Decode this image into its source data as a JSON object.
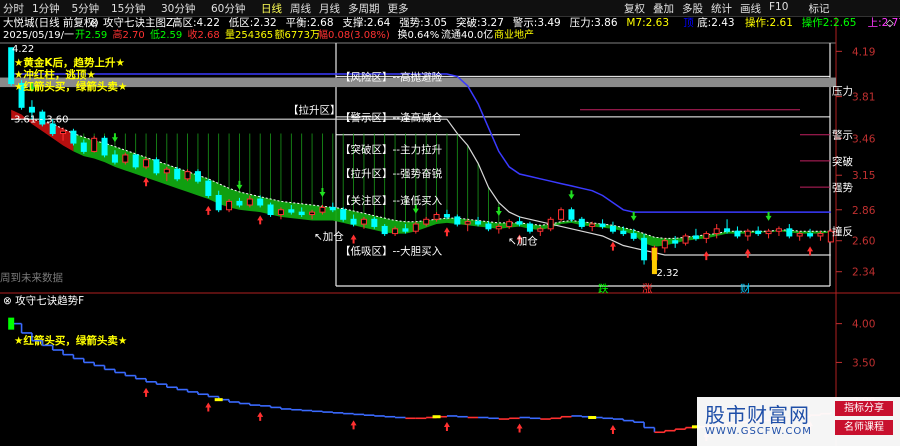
{
  "toolbar": {
    "left_items": [
      "分时",
      "1分钟",
      "5分钟",
      "15分钟",
      "30分钟",
      "60分钟",
      "日线",
      "周线",
      "月线",
      "多周期",
      "更多"
    ],
    "active": "日线",
    "right_items": [
      "复权",
      "叠加",
      "多股",
      "统计",
      "画线",
      "F10",
      "标记"
    ],
    "icons": [
      "chevron-down-icon",
      "pin-icon",
      "maximize-icon"
    ]
  },
  "colors": {
    "background": "#000000",
    "up": "#ff3232",
    "down": "#00ffff",
    "ma_cyan": "#00ffff",
    "cloud_green": "#11a811",
    "cloud_red": "#c01010",
    "upper_band": "#3a3aff",
    "lower_band": "#d8d8d8",
    "axis_red": "#c03030",
    "label_yellow": "#ffff00",
    "label_white": "#ffffff"
  },
  "main_panel": {
    "stock_name": "大悦城(日线 前复权)",
    "indicator_name": "攻守七诀主图Z",
    "indicators": [
      {
        "label": "高区:",
        "value": "4.22",
        "color": "#ffffff"
      },
      {
        "label": "低区:",
        "value": "2.32",
        "color": "#ffffff"
      },
      {
        "label": "平衡:",
        "value": "2.68",
        "color": "#ffffff"
      },
      {
        "label": "支撑:",
        "value": "2.64",
        "color": "#ffffff"
      },
      {
        "label": "强势:",
        "value": "3.05",
        "color": "#ffffff"
      },
      {
        "label": "突破:",
        "value": "3.27",
        "color": "#ffffff"
      },
      {
        "label": "警示:",
        "value": "3.49",
        "color": "#ffffff"
      },
      {
        "label": "压力:",
        "value": "3.86",
        "color": "#ffffff"
      },
      {
        "label": "M7:",
        "value": "2.63",
        "color": "#ffff00"
      },
      {
        "label": "顶",
        "value": "",
        "color": "#0000ff"
      },
      {
        "label": "底:",
        "value": "2.43",
        "color": "#ffffff"
      },
      {
        "label": "操作:",
        "value": "2.61",
        "color": "#ffff00"
      },
      {
        "label": "操作2:",
        "value": "2.65",
        "color": "#00ff00"
      },
      {
        "label": "上:",
        "value": "2.77",
        "color": "#ff3aff"
      },
      {
        "label": "下:",
        "value": "",
        "color": "#00ffff"
      }
    ],
    "quote_date": "2025/05/19/一",
    "quote": [
      {
        "label": "开",
        "value": "2.59",
        "color": "#00ff00"
      },
      {
        "label": "高",
        "value": "2.70",
        "color": "#ff3232"
      },
      {
        "label": "低",
        "value": "2.59",
        "color": "#00ff00"
      },
      {
        "label": "收",
        "value": "2.68",
        "color": "#ff3232"
      },
      {
        "label": "量",
        "value": "254365",
        "color": "#ffff00"
      },
      {
        "label": "额",
        "value": "6773万",
        "color": "#ffff00"
      },
      {
        "label": "幅",
        "value": "0.08(3.08%)",
        "color": "#ff3232"
      },
      {
        "label": "换",
        "value": "0.64%",
        "color": "#ffffff"
      },
      {
        "label": "流通",
        "value": "40.0亿",
        "color": "#ffffff"
      },
      {
        "label": "",
        "value": "商业地产",
        "color": "#ffff00"
      }
    ],
    "signals": [
      "★黄金K后，趋势上升★",
      "★冲红柱，逃顶★",
      "★红箭头买，绿箭头卖★"
    ],
    "watermark_note": "周到未来数据",
    "zone_labels": [
      {
        "text": "【风险区】--高抛避险",
        "value": 3.98
      },
      {
        "text": "【拉升区】",
        "value": 3.7
      },
      {
        "text": "【警示区】--逢高减仓",
        "value": 3.64
      },
      {
        "text": "【突破区】--主力拉升",
        "value": 3.37
      },
      {
        "text": "【拉升区】--强势奋锐",
        "value": 3.17
      },
      {
        "text": "【关注区】--逢低买入",
        "value": 2.94
      },
      {
        "text": "【低吸区】--大胆买入",
        "value": 2.52
      }
    ],
    "level_tags": [
      {
        "text": "压力",
        "value": 3.86
      },
      {
        "text": "警示",
        "value": 3.49
      },
      {
        "text": "突破",
        "value": 3.27
      },
      {
        "text": "强势",
        "value": 3.05
      },
      {
        "text": "撞反",
        "value": 2.68
      }
    ],
    "price_labels": [
      {
        "text": "4.22",
        "value": 4.22
      },
      {
        "text": "3.61 - 3.60",
        "value": 3.61
      },
      {
        "text": "2.32",
        "value": 2.32
      }
    ],
    "jiacang_labels": [
      "加仓",
      "加仓"
    ],
    "bottom_labels": [
      {
        "text": "跌",
        "color": "#00ff00"
      },
      {
        "text": "涨",
        "color": "#ff3232"
      },
      {
        "text": "财",
        "color": "#00ccff"
      }
    ]
  },
  "sub_panel": {
    "indicator_name": "攻守七诀趋势F",
    "signal": "★红箭头买，绿箭头卖★"
  },
  "watermark": {
    "title": "股市财富网",
    "url": "WWW.GSCFW.COM",
    "tag1": "指标分享",
    "tag2": "名师课程"
  },
  "chart_data": [
    {
      "type": "candlestick",
      "title": "攻守七诀主图Z",
      "y_ticks": [
        4.19,
        3.81,
        3.46,
        3.15,
        2.86,
        2.6,
        2.34
      ],
      "ylim": [
        2.22,
        4.26
      ],
      "levels": {
        "高区": 4.22,
        "低区": 2.32,
        "平衡": 2.68,
        "支撑": 2.64,
        "强势": 3.05,
        "突破": 3.27,
        "警示": 3.49,
        "压力": 3.86
      },
      "candles": [
        [
          4.22,
          4.22,
          3.9,
          3.92
        ],
        [
          3.92,
          3.95,
          3.7,
          3.72
        ],
        [
          3.72,
          3.78,
          3.62,
          3.68
        ],
        [
          3.68,
          3.7,
          3.56,
          3.58
        ],
        [
          3.58,
          3.62,
          3.48,
          3.5
        ],
        [
          3.5,
          3.55,
          3.44,
          3.52
        ],
        [
          3.52,
          3.54,
          3.4,
          3.42
        ],
        [
          3.42,
          3.45,
          3.33,
          3.35
        ],
        [
          3.35,
          3.48,
          3.34,
          3.46
        ],
        [
          3.46,
          3.48,
          3.3,
          3.32
        ],
        [
          3.32,
          3.36,
          3.24,
          3.26
        ],
        [
          3.26,
          3.34,
          3.24,
          3.32
        ],
        [
          3.32,
          3.33,
          3.2,
          3.22
        ],
        [
          3.22,
          3.3,
          3.2,
          3.28
        ],
        [
          3.28,
          3.3,
          3.15,
          3.17
        ],
        [
          3.17,
          3.22,
          3.1,
          3.2
        ],
        [
          3.2,
          3.22,
          3.1,
          3.12
        ],
        [
          3.12,
          3.2,
          3.1,
          3.18
        ],
        [
          3.18,
          3.2,
          3.08,
          3.1
        ],
        [
          3.1,
          3.12,
          2.96,
          2.98
        ],
        [
          2.98,
          3.02,
          2.84,
          2.86
        ],
        [
          2.86,
          2.95,
          2.84,
          2.93
        ],
        [
          2.93,
          2.96,
          2.88,
          2.9
        ],
        [
          2.9,
          2.98,
          2.88,
          2.95
        ],
        [
          2.95,
          2.98,
          2.88,
          2.9
        ],
        [
          2.9,
          2.92,
          2.8,
          2.82
        ],
        [
          2.82,
          2.88,
          2.78,
          2.86
        ],
        [
          2.86,
          2.9,
          2.82,
          2.84
        ],
        [
          2.84,
          2.88,
          2.8,
          2.82
        ],
        [
          2.82,
          2.86,
          2.78,
          2.84
        ],
        [
          2.84,
          2.9,
          2.82,
          2.88
        ],
        [
          2.88,
          2.92,
          2.84,
          2.86
        ],
        [
          2.86,
          2.88,
          2.76,
          2.78
        ],
        [
          2.78,
          2.82,
          2.72,
          2.74
        ],
        [
          2.74,
          2.8,
          2.7,
          2.78
        ],
        [
          2.78,
          2.8,
          2.7,
          2.72
        ],
        [
          2.72,
          2.74,
          2.64,
          2.66
        ],
        [
          2.66,
          2.72,
          2.64,
          2.7
        ],
        [
          2.7,
          2.74,
          2.66,
          2.68
        ],
        [
          2.68,
          2.76,
          2.66,
          2.74
        ],
        [
          2.74,
          2.8,
          2.72,
          2.78
        ],
        [
          2.78,
          2.84,
          2.76,
          2.82
        ],
        [
          2.82,
          2.86,
          2.78,
          2.8
        ],
        [
          2.8,
          2.82,
          2.72,
          2.74
        ],
        [
          2.74,
          2.78,
          2.68,
          2.76
        ],
        [
          2.76,
          2.8,
          2.72,
          2.74
        ],
        [
          2.74,
          2.76,
          2.68,
          2.7
        ],
        [
          2.7,
          2.74,
          2.66,
          2.72
        ],
        [
          2.72,
          2.78,
          2.7,
          2.76
        ],
        [
          2.76,
          2.8,
          2.72,
          2.74
        ],
        [
          2.74,
          2.76,
          2.66,
          2.68
        ],
        [
          2.68,
          2.72,
          2.64,
          2.7
        ],
        [
          2.7,
          2.8,
          2.68,
          2.78
        ],
        [
          2.78,
          2.88,
          2.76,
          2.86
        ],
        [
          2.86,
          2.88,
          2.76,
          2.78
        ],
        [
          2.78,
          2.8,
          2.7,
          2.72
        ],
        [
          2.72,
          2.76,
          2.68,
          2.74
        ],
        [
          2.74,
          2.78,
          2.7,
          2.72
        ],
        [
          2.72,
          2.76,
          2.66,
          2.68
        ],
        [
          2.68,
          2.72,
          2.64,
          2.66
        ],
        [
          2.66,
          2.7,
          2.6,
          2.62
        ],
        [
          2.62,
          2.66,
          2.4,
          2.44
        ],
        [
          2.44,
          2.56,
          2.32,
          2.54
        ],
        [
          2.54,
          2.62,
          2.5,
          2.6
        ],
        [
          2.6,
          2.64,
          2.54,
          2.58
        ],
        [
          2.58,
          2.66,
          2.56,
          2.64
        ],
        [
          2.64,
          2.7,
          2.6,
          2.62
        ],
        [
          2.62,
          2.68,
          2.58,
          2.66
        ],
        [
          2.66,
          2.74,
          2.62,
          2.7
        ],
        [
          2.7,
          2.78,
          2.66,
          2.68
        ],
        [
          2.68,
          2.72,
          2.62,
          2.64
        ],
        [
          2.64,
          2.7,
          2.6,
          2.68
        ],
        [
          2.68,
          2.72,
          2.64,
          2.66
        ],
        [
          2.66,
          2.7,
          2.62,
          2.68
        ],
        [
          2.68,
          2.72,
          2.64,
          2.7
        ],
        [
          2.7,
          2.74,
          2.62,
          2.64
        ],
        [
          2.64,
          2.68,
          2.6,
          2.66
        ],
        [
          2.66,
          2.7,
          2.62,
          2.64
        ],
        [
          2.64,
          2.68,
          2.6,
          2.66
        ],
        [
          2.59,
          2.7,
          2.59,
          2.68
        ]
      ],
      "upper_band": [
        4.0,
        4.0,
        4.0,
        4.0,
        4.0,
        4.0,
        4.0,
        4.0,
        4.0,
        4.0,
        4.0,
        4.0,
        4.0,
        4.0,
        4.0,
        4.0,
        4.0,
        4.0,
        4.0,
        4.0,
        4.0,
        4.0,
        4.0,
        4.0,
        4.0,
        4.0,
        4.0,
        4.0,
        4.0,
        4.0,
        4.0,
        4.0,
        4.0,
        4.0,
        4.0,
        4.0,
        4.0,
        4.0,
        4.0,
        4.0,
        4.0,
        4.0,
        4.0,
        3.98,
        3.9,
        3.75,
        3.55,
        3.35,
        3.22,
        3.16,
        3.14,
        3.12,
        3.1,
        3.08,
        3.06,
        3.04,
        3.02,
        2.98,
        2.92,
        2.86,
        2.84,
        2.84,
        2.84,
        2.84,
        2.84,
        2.84,
        2.84,
        2.84,
        2.84,
        2.84,
        2.84,
        2.84,
        2.84,
        2.84,
        2.84,
        2.84,
        2.84,
        2.84,
        2.84,
        2.84
      ],
      "lower_band": [
        3.62,
        3.62,
        3.62,
        3.62,
        3.62,
        3.62,
        3.62,
        3.62,
        3.62,
        3.62,
        3.62,
        3.62,
        3.62,
        3.62,
        3.62,
        3.62,
        3.62,
        3.62,
        3.62,
        3.62,
        3.62,
        3.62,
        3.62,
        3.62,
        3.62,
        3.62,
        3.62,
        3.62,
        3.62,
        3.62,
        3.62,
        3.62,
        3.62,
        3.62,
        3.62,
        3.62,
        3.62,
        3.62,
        3.62,
        3.62,
        3.62,
        3.62,
        3.62,
        3.5,
        3.4,
        3.25,
        3.05,
        2.92,
        2.84,
        2.8,
        2.78,
        2.76,
        2.74,
        2.72,
        2.7,
        2.68,
        2.66,
        2.64,
        2.6,
        2.56,
        2.54,
        2.52,
        2.5,
        2.48,
        2.48,
        2.48,
        2.48,
        2.48,
        2.48,
        2.48,
        2.48,
        2.48,
        2.48,
        2.48,
        2.48,
        2.48,
        2.48,
        2.48,
        2.48,
        2.48
      ],
      "cloud_upper": [
        3.62,
        3.62,
        3.62,
        3.6,
        3.58,
        3.54,
        3.5,
        3.47,
        3.44,
        3.42,
        3.39,
        3.36,
        3.33,
        3.3,
        3.27,
        3.24,
        3.21,
        3.18,
        3.15,
        3.12,
        3.08,
        3.04,
        3.01,
        2.99,
        2.97,
        2.95,
        2.93,
        2.92,
        2.91,
        2.9,
        2.89,
        2.88,
        2.87,
        2.85,
        2.83,
        2.81,
        2.79,
        2.77,
        2.76,
        2.76,
        2.77,
        2.78,
        2.79,
        2.79,
        2.78,
        2.77,
        2.76,
        2.75,
        2.75,
        2.75,
        2.74,
        2.73,
        2.74,
        2.76,
        2.77,
        2.76,
        2.75,
        2.74,
        2.73,
        2.71,
        2.69,
        2.66,
        2.63,
        2.62,
        2.62,
        2.63,
        2.64,
        2.65,
        2.66,
        2.68,
        2.68,
        2.68,
        2.68,
        2.68,
        2.69,
        2.69,
        2.68,
        2.68,
        2.68,
        2.68
      ],
      "cloud_lower": [
        3.7,
        3.66,
        3.58,
        3.52,
        3.46,
        3.4,
        3.35,
        3.31,
        3.29,
        3.26,
        3.22,
        3.19,
        3.16,
        3.13,
        3.1,
        3.07,
        3.04,
        3.01,
        2.98,
        2.95,
        2.91,
        2.88,
        2.86,
        2.85,
        2.84,
        2.82,
        2.8,
        2.79,
        2.78,
        2.77,
        2.77,
        2.77,
        2.75,
        2.73,
        2.71,
        2.69,
        2.67,
        2.66,
        2.66,
        2.68,
        2.71,
        2.74,
        2.75,
        2.74,
        2.73,
        2.72,
        2.71,
        2.7,
        2.71,
        2.72,
        2.7,
        2.69,
        2.71,
        2.74,
        2.75,
        2.73,
        2.72,
        2.71,
        2.7,
        2.68,
        2.65,
        2.58,
        2.55,
        2.56,
        2.58,
        2.6,
        2.61,
        2.62,
        2.64,
        2.66,
        2.66,
        2.66,
        2.67,
        2.67,
        2.68,
        2.67,
        2.66,
        2.66,
        2.66,
        2.67
      ],
      "buy_arrows": [
        13,
        19,
        24,
        33,
        42,
        49,
        58,
        67,
        71,
        77
      ],
      "sell_arrows": [
        2,
        10,
        22,
        30,
        39,
        47,
        54,
        60,
        73
      ]
    },
    {
      "type": "line",
      "title": "攻守七诀趋势F",
      "y_ticks": [
        4.0,
        3.5,
        3.0
      ],
      "ylim": [
        2.5,
        4.15
      ],
      "values": [
        4.0,
        3.88,
        3.78,
        3.72,
        3.66,
        3.6,
        3.55,
        3.5,
        3.46,
        3.41,
        3.37,
        3.33,
        3.29,
        3.25,
        3.22,
        3.18,
        3.15,
        3.12,
        3.09,
        3.06,
        3.02,
        2.99,
        2.97,
        2.95,
        2.94,
        2.92,
        2.9,
        2.89,
        2.88,
        2.87,
        2.86,
        2.85,
        2.84,
        2.83,
        2.82,
        2.81,
        2.8,
        2.79,
        2.78,
        2.78,
        2.79,
        2.8,
        2.81,
        2.8,
        2.79,
        2.79,
        2.78,
        2.77,
        2.78,
        2.79,
        2.78,
        2.77,
        2.78,
        2.8,
        2.81,
        2.8,
        2.79,
        2.78,
        2.77,
        2.75,
        2.73,
        2.66,
        2.6,
        2.62,
        2.64,
        2.66,
        2.67,
        2.68,
        2.7,
        2.72,
        2.73,
        2.74,
        2.75,
        2.76,
        2.77,
        2.78,
        2.8,
        2.82,
        2.84,
        2.86
      ],
      "buy_arrows": [
        13,
        19,
        24,
        33,
        42,
        49,
        58,
        67,
        71,
        77
      ]
    }
  ]
}
